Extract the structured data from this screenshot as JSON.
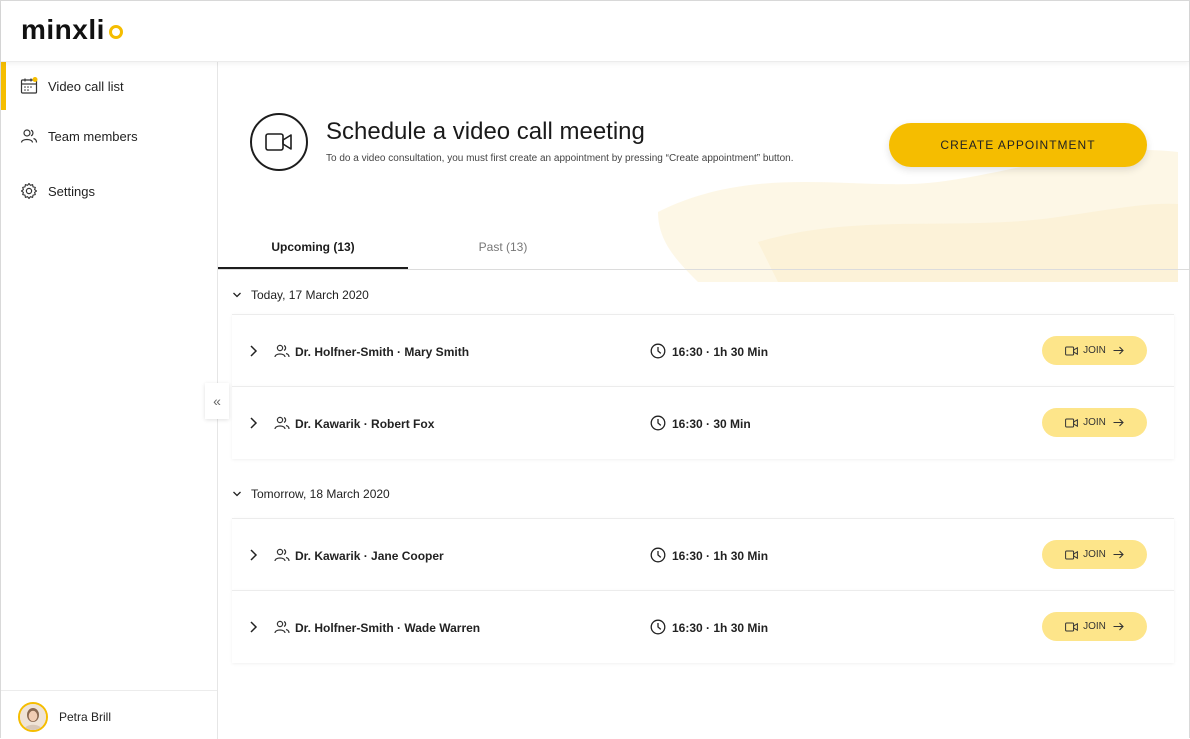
{
  "app": {
    "logo": "minxli"
  },
  "colors": {
    "accent": "#f5bd00",
    "join_bg": "#fde58a"
  },
  "sidebar": {
    "items": [
      {
        "label": "Video call list",
        "icon": "calendar-icon",
        "active": true
      },
      {
        "label": "Team members",
        "icon": "team-icon",
        "active": false
      },
      {
        "label": "Settings",
        "icon": "gear-icon",
        "active": false
      }
    ],
    "user": {
      "name": "Petra Brill"
    }
  },
  "hero": {
    "title": "Schedule a video call meeting",
    "subtitle": "To do a video consultation, you must first create an appointment by pressing “Create appointment” button.",
    "create_button": "CREATE APPOINTMENT"
  },
  "tabs": [
    {
      "label": "Upcoming (13)",
      "active": true
    },
    {
      "label": "Past (13)",
      "active": false
    }
  ],
  "groups": [
    {
      "header": "Today, 17 March 2020",
      "rows": [
        {
          "names": "Dr. Holfner-Smith · Mary Smith",
          "time": "16:30 · 1h 30 Min",
          "join": "JOIN"
        },
        {
          "names": "Dr. Kawarik · Robert Fox",
          "time": "16:30 · 30 Min",
          "join": "JOIN"
        }
      ]
    },
    {
      "header": "Tomorrow, 18 March 2020",
      "rows": [
        {
          "names": "Dr. Kawarik · Jane Cooper",
          "time": "16:30 · 1h 30 Min",
          "join": "JOIN"
        },
        {
          "names": "Dr. Holfner-Smith · Wade Warren",
          "time": "16:30 · 1h 30 Min",
          "join": "JOIN"
        }
      ]
    }
  ]
}
